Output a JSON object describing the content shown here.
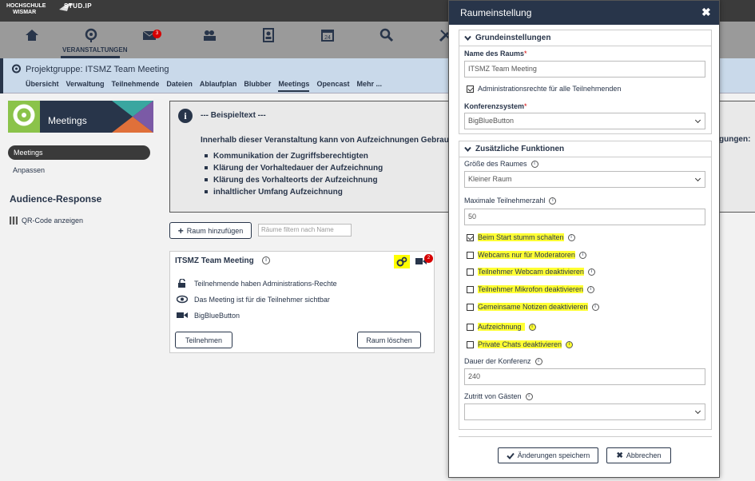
{
  "brand": {
    "hs_line1": "HOCHSCHULE",
    "hs_line2": "WISMAR",
    "studip": "STUD.IP"
  },
  "nav": {
    "veranstaltungen_label": "VERANSTALTUNGEN",
    "messages_badge": "3"
  },
  "context": {
    "title": "Projektgruppe: ITSMZ Team Meeting",
    "tabs": [
      "Übersicht",
      "Verwaltung",
      "Teilnehmende",
      "Dateien",
      "Ablaufplan",
      "Blubber",
      "Meetings",
      "Opencast",
      "Mehr ..."
    ]
  },
  "sidebar": {
    "image_label": "Meetings",
    "menu_active": "Meetings",
    "menu_item": "Anpassen",
    "section_title": "Audience-Response",
    "qr_label": "QR-Code anzeigen"
  },
  "info": {
    "title": "--- Beispieltext ---",
    "text": "Innerhalb dieser Veranstaltung kann von Aufzeichnungen Gebrauch",
    "text_tail": "gungen:",
    "items": [
      "Kommunikation der Zugriffsberechtigten",
      "Klärung der Vorhaltedauer der Aufzeichnung",
      "Klärung des Vorhalteorts der Aufzeichnung",
      "inhaltlicher Umfang Aufzeichnung"
    ]
  },
  "rooms": {
    "add_label": "Raum hinzufügen",
    "filter_placeholder": "Räume filtern nach Name",
    "room": {
      "title": "ITSMZ Team Meeting",
      "badge": "2",
      "rows": [
        "Teilnehmende haben Administrations-Rechte",
        "Das Meeting ist für die Teilnehmer sichtbar",
        "BigBlueButton"
      ],
      "join_label": "Teilnehmen",
      "delete_label": "Raum löschen"
    }
  },
  "modal": {
    "title": "Raumeinstellung",
    "close": "✖",
    "basic": {
      "legend": "Grundeinstellungen",
      "name_label": "Name des Raums",
      "name_value": "ITSMZ Team Meeting",
      "admin_cb": "Administrationsrechte für alle Teilnehmenden",
      "system_label": "Konferenzsystem",
      "system_value": "BigBlueButton"
    },
    "extra": {
      "legend": "Zusätzliche Funktionen",
      "size_label": "Größe des Raumes",
      "size_value": "Kleiner Raum",
      "max_label": "Maximale Teilnehmerzahl",
      "max_value": "50",
      "options": [
        {
          "label": "Beim Start stumm schalten",
          "checked": true
        },
        {
          "label": "Webcams nur für Moderatoren",
          "checked": false
        },
        {
          "label": "Teilnehmer Webcam deaktivieren",
          "checked": false
        },
        {
          "label": "Teilnehmer Mikrofon deaktivieren",
          "checked": false
        },
        {
          "label": "Gemeinsame Notizen deaktivieren",
          "checked": false
        },
        {
          "label": "Aufzeichnung",
          "checked": false
        },
        {
          "label": "Private Chats deaktivieren",
          "checked": false
        }
      ],
      "duration_label": "Dauer der Konferenz",
      "duration_value": "240",
      "guest_label": "Zutritt von Gästen",
      "guest_value": ""
    },
    "save_label": "Änderungen speichern",
    "cancel_label": "Abbrechen"
  },
  "colors": {
    "accent": "#28354a",
    "highlight": "#ffff33",
    "required": "#d60000"
  }
}
